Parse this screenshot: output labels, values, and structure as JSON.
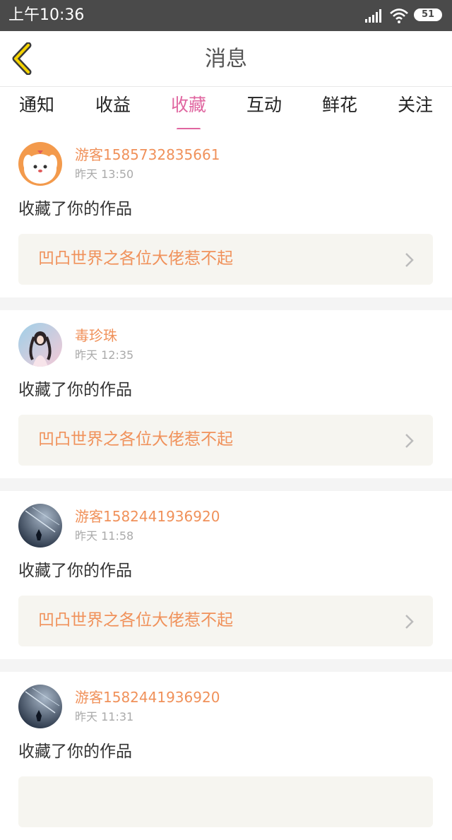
{
  "status_bar": {
    "time": "上午10:36",
    "battery": "51"
  },
  "header": {
    "title": "消息"
  },
  "tabs": [
    {
      "label": "通知",
      "active": false
    },
    {
      "label": "收益",
      "active": false
    },
    {
      "label": "收藏",
      "active": true
    },
    {
      "label": "互动",
      "active": false
    },
    {
      "label": "鲜花",
      "active": false
    },
    {
      "label": "关注",
      "active": false
    }
  ],
  "messages": [
    {
      "username": "游客1585732835661",
      "time": "昨天 13:50",
      "action": "收藏了你的作品",
      "work_title": "凹凸世界之各位大佬惹不起"
    },
    {
      "username": "毒珍珠",
      "time": "昨天 12:35",
      "action": "收藏了你的作品",
      "work_title": "凹凸世界之各位大佬惹不起"
    },
    {
      "username": "游客1582441936920",
      "time": "昨天 11:58",
      "action": "收藏了你的作品",
      "work_title": "凹凸世界之各位大佬惹不起"
    },
    {
      "username": "游客1582441936920",
      "time": "昨天 11:31",
      "action": "收藏了你的作品",
      "work_title": ""
    }
  ],
  "colors": {
    "accent": "#e066a0",
    "name_orange": "#f0915a",
    "status_bar": "#4a4a4a"
  }
}
